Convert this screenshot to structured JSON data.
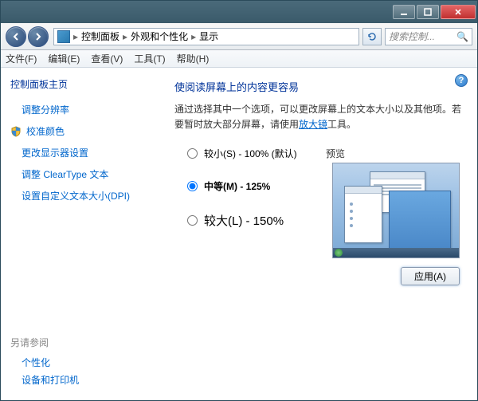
{
  "titlebar": {
    "min_tip": "最小化",
    "max_tip": "最大化",
    "close_tip": "关闭"
  },
  "breadcrumb": {
    "root": "控制面板",
    "level1": "外观和个性化",
    "level2": "显示",
    "sep": "▸"
  },
  "search": {
    "placeholder": "搜索控制..."
  },
  "menu": {
    "file": "文件(F)",
    "edit": "编辑(E)",
    "view": "查看(V)",
    "tools": "工具(T)",
    "help": "帮助(H)"
  },
  "sidebar": {
    "home": "控制面板主页",
    "links": [
      {
        "label": "调整分辨率"
      },
      {
        "label": "校准颜色",
        "shield": true
      },
      {
        "label": "更改显示器设置"
      },
      {
        "label": "调整 ClearType 文本"
      },
      {
        "label": "设置自定义文本大小(DPI)"
      }
    ],
    "seealso_heading": "另请参阅",
    "seealso": [
      {
        "label": "个性化"
      },
      {
        "label": "设备和打印机"
      }
    ]
  },
  "main": {
    "title": "使阅读屏幕上的内容更容易",
    "desc_pre": "通过选择其中一个选项，可以更改屏幕上的文本大小以及其他项。若要暂时放大部分屏幕，请使用",
    "magnifier_link": "放大镜",
    "desc_post": "工具。",
    "options": [
      {
        "key": "small",
        "label": "较小(S) - 100% (默认)"
      },
      {
        "key": "medium",
        "label": "中等(M) - 125%"
      },
      {
        "key": "large",
        "label": "较大(L) - 150%"
      }
    ],
    "selected": "medium",
    "preview_label": "预览",
    "apply": "应用(A)"
  }
}
